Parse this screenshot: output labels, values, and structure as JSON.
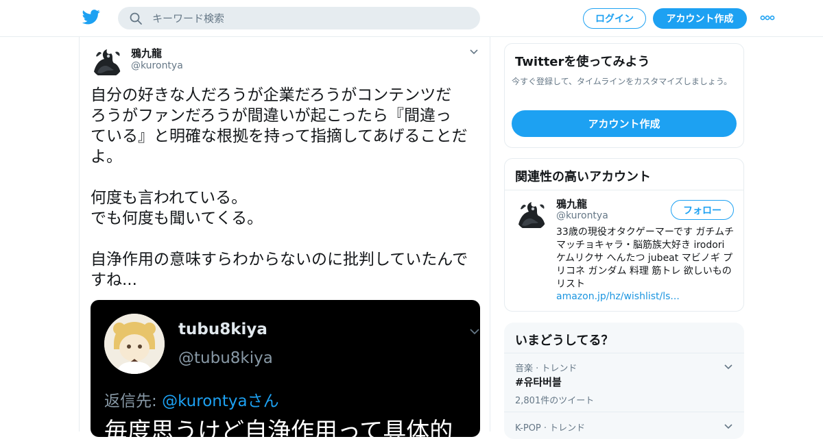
{
  "header": {
    "search_placeholder": "キーワード検索",
    "login_label": "ログイン",
    "signup_label": "アカウント作成",
    "brand_color": "#1da1f2"
  },
  "tweet": {
    "display_name": "鴉九龍",
    "handle": "@kurontya",
    "text": "自分の好きな人だろうが企業だろうがコンテンツだ\nろうがファンだろうが間違いが起こったら『間違っ\nている』と明確な根拠を持って指摘してあげることだ\nよ。\n\n何度も言われている。\nでも何度も聞いてくる。\n\n自浄作用の意味すらわからないのに批判していたんで\nすね...",
    "media": {
      "name": "tubu8kiya",
      "handle": "@tubu8kiya",
      "reply_prefix": "返信先: ",
      "reply_mention": "@kurontyaさん",
      "body": "毎度思うけど自浄作用って具体的"
    }
  },
  "signup_card": {
    "title": "Twitterを使ってみよう",
    "description": "今すぐ登録して、タイムラインをカスタマイズしましょう。",
    "button": "アカウント作成"
  },
  "related_card": {
    "title": "関連性の高いアカウント",
    "account": {
      "name": "鴉九龍",
      "handle": "@kurontya",
      "follow_label": "フォロー",
      "bio": "33歳の現役オタクゲーマーです ガチムチマッチョキャラ・脳筋族大好き irodori ケムリクサ へんたつ jubeat マビノギ プリコネ ガンダム 料理 筋トレ 欲しいものリスト",
      "link": "amazon.jp/hz/wishlist/ls..."
    }
  },
  "trends_card": {
    "title": "いまどうしてる？",
    "trends": [
      {
        "meta": "音楽 · トレンド",
        "name": "#유타버블",
        "count": "2,801件のツイート"
      },
      {
        "meta": "K-POP · トレンド",
        "name": "",
        "count": ""
      }
    ]
  }
}
